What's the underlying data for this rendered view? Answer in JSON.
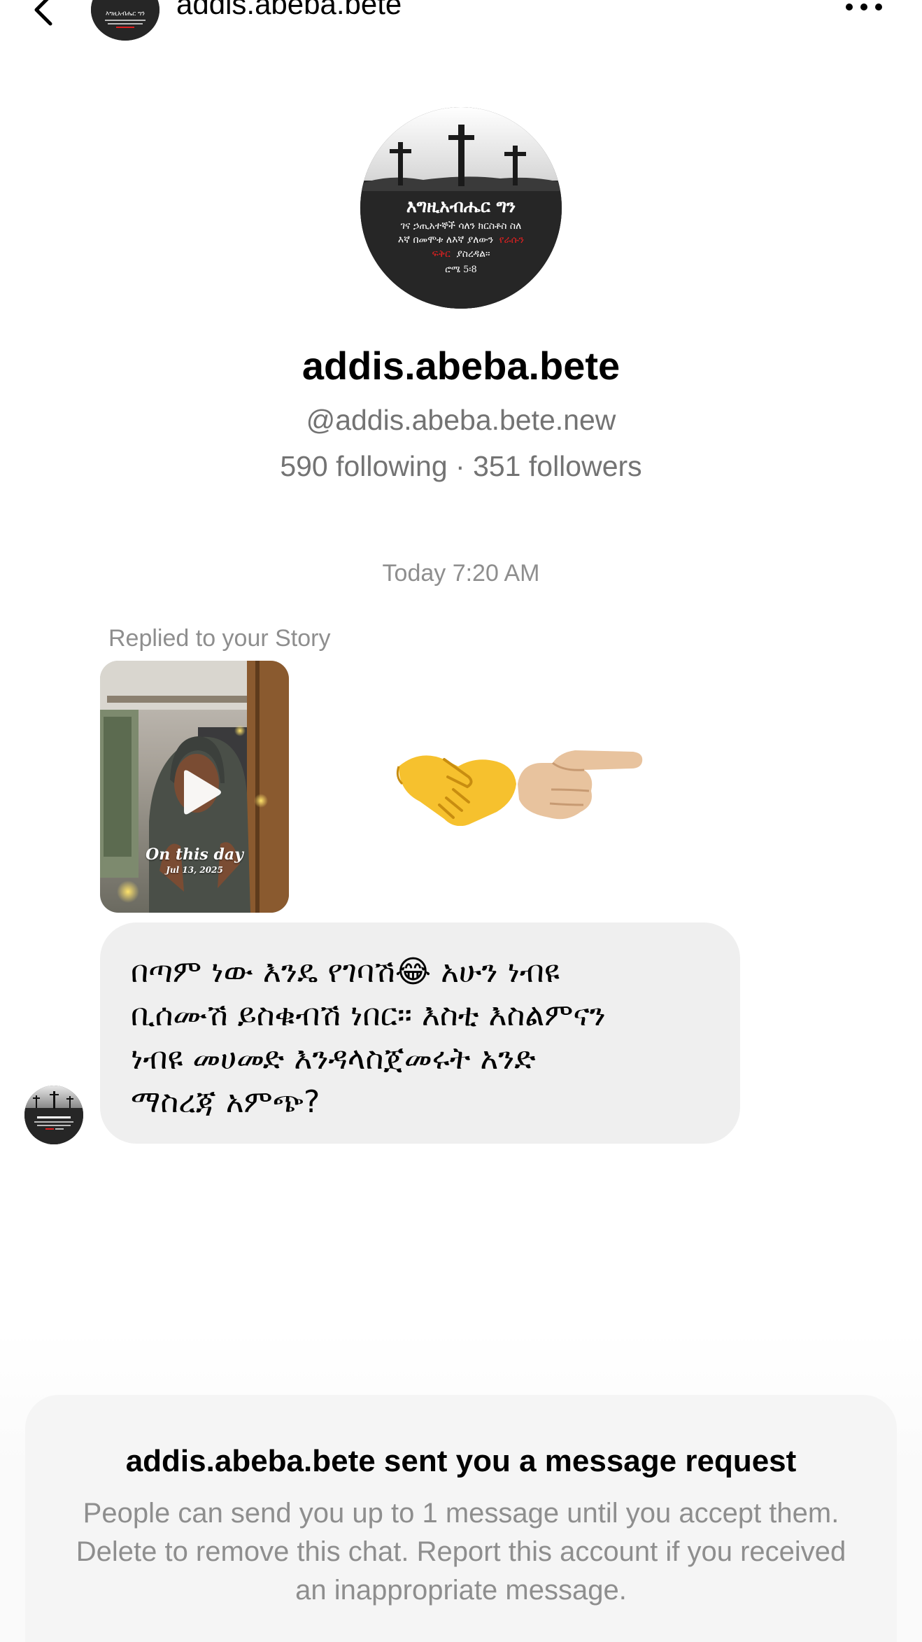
{
  "header": {
    "title": "addis.abeba.bete",
    "back_icon": "chevron-left-icon",
    "more_icon": "more-horizontal-icon"
  },
  "profile": {
    "name": "addis.abeba.bete",
    "handle": "@addis.abeba.bete.new",
    "stats": "590 following · 351 followers",
    "avatar_text": {
      "title": "እግዚአብሔር ግን",
      "line1": "ገና ኃጢአተኞች ሳለን ክርስቶስ ስለ",
      "line2": "እኛ በመሞቱ ለእኛ ያለውን",
      "highlight1": "የራሱን",
      "highlight2": "ፍቅር",
      "line3_rest": "ያስረዳል።",
      "reference": "ሮሜ 5፡8"
    }
  },
  "conversation": {
    "timestamp": "Today 7:20 AM",
    "replied_label": "Replied to your Story",
    "story": {
      "caption": "On this day",
      "date": "Jul 13, 2025"
    },
    "reaction_emojis": "🤝👉",
    "message": "በጣም ነው እንዴ የገባሽ😂 አሁን ነብዩ\nቢሰሙሽ ይስቁብሽ ነበር፡፡ እስቲ እስልምናን\nነብዩ መሀመድ እንዳላስጀመሩት አንድ\nማስረጃ አምጭ?"
  },
  "request": {
    "title": "addis.abeba.bete sent you a message request",
    "body": "People can send you up to 1 message until you accept them. Delete to remove this chat. Report this account if you received an inappropriate message."
  },
  "colors": {
    "secondary_text": "#737373",
    "bubble_bg": "#efefef",
    "card_bg": "#f5f5f5",
    "accent_red": "#e02020"
  }
}
